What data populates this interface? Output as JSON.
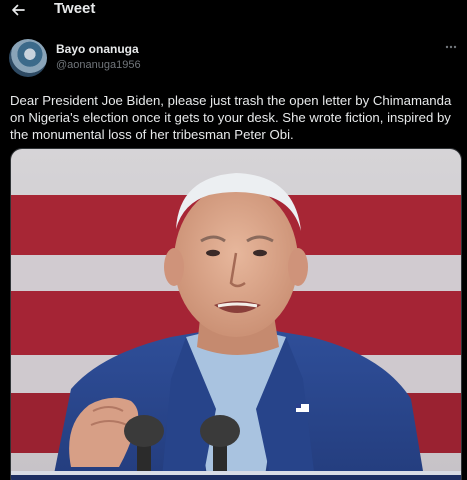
{
  "header": {
    "title": "Tweet",
    "back_icon": "arrow-left-icon"
  },
  "author": {
    "name": "Bayo onanuga",
    "handle": "@aonanuga1956",
    "avatar_icon": "avatar"
  },
  "tweet": {
    "text": "Dear President Joe Biden, please just trash the open letter by Chimamanda on Nigeria's election once it gets to your desk. She wrote fiction, inspired by the monumental loss of her tribesman Peter Obi."
  },
  "media": {
    "kind": "photo"
  },
  "colors": {
    "background": "#000000",
    "text": "#e7e9ea",
    "secondary_text": "#71767b",
    "border": "#2f3336"
  }
}
